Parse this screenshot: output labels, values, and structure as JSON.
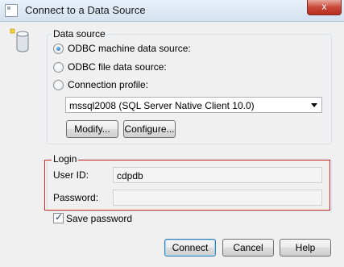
{
  "window": {
    "title": "Connect to a Data Source",
    "close_label": "x"
  },
  "data_source": {
    "group_label": "Data source",
    "options": [
      {
        "label": "ODBC machine data source:",
        "checked": true
      },
      {
        "label": "ODBC file data source:",
        "checked": false
      },
      {
        "label": "Connection profile:",
        "checked": false
      }
    ],
    "selected_source": "mssql2008 (SQL Server Native Client 10.0)",
    "modify_label": "Modify...",
    "configure_label": "Configure..."
  },
  "login": {
    "group_label": "Login",
    "user_id_label": "User ID:",
    "user_id_value": "cdpdb",
    "password_label": "Password:",
    "password_value": "",
    "save_password_label": "Save password",
    "save_password_checked": true
  },
  "buttons": {
    "connect": "Connect",
    "cancel": "Cancel",
    "help": "Help"
  },
  "colors": {
    "highlight_border": "#d32a2a",
    "default_button_border": "#3c7fb1"
  }
}
